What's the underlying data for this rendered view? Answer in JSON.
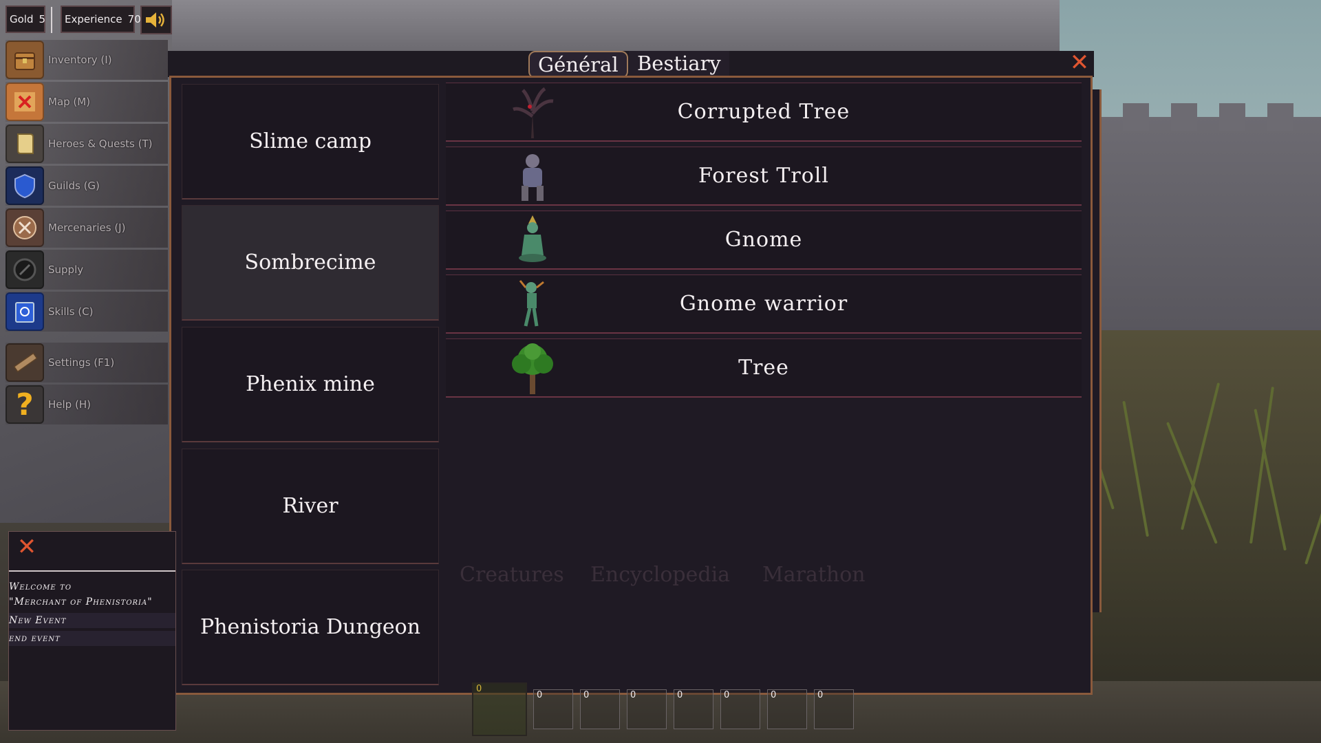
{
  "hud": {
    "gold_label": "Gold",
    "gold_value": "5",
    "experience_label": "Experience",
    "experience_value": "70"
  },
  "menu": [
    {
      "label": "Inventory (I)",
      "icon": "chest-icon"
    },
    {
      "label": "Map (M)",
      "icon": "map-icon"
    },
    {
      "label": "Heroes & Quests (T)",
      "icon": "scroll-icon"
    },
    {
      "label": "Guilds (G)",
      "icon": "guild-shield-icon"
    },
    {
      "label": "Mercenaries (J)",
      "icon": "crossed-axes-icon"
    },
    {
      "label": "Supply",
      "icon": "supply-icon"
    },
    {
      "label": "Skills (C)",
      "icon": "spellbook-icon"
    },
    {
      "label": "Settings (F1)",
      "icon": "ruler-icon"
    },
    {
      "label": "Help (H)",
      "icon": "question-icon"
    }
  ],
  "panel": {
    "tabs": [
      "Général",
      "Bestiary"
    ],
    "regions": [
      "Slime camp",
      "Sombrecime",
      "Phenix mine",
      "River",
      "Phenistoria Dungeon"
    ],
    "selected_region": "Sombrecime",
    "creatures": [
      {
        "name": "Corrupted Tree",
        "icon": "corrupted-tree-icon"
      },
      {
        "name": "Forest Troll",
        "icon": "forest-troll-icon"
      },
      {
        "name": "Gnome",
        "icon": "gnome-icon"
      },
      {
        "name": "Gnome warrior",
        "icon": "gnome-warrior-icon"
      },
      {
        "name": "Tree",
        "icon": "tree-icon"
      }
    ],
    "faded_tabs": [
      "Creatures",
      "Encyclopedia",
      "Marathon"
    ]
  },
  "chat": {
    "messages": [
      "Welcome to",
      "\"Merchant of Phenistoria\"",
      "New Event",
      "end event"
    ]
  },
  "hotbar": {
    "slots": [
      "0",
      "0",
      "0",
      "0",
      "0",
      "0",
      "0",
      "0"
    ]
  },
  "colors": {
    "panel_border": "#8a5a3c",
    "close_x": "#e05530",
    "sound_icon": "#e6b23a"
  }
}
